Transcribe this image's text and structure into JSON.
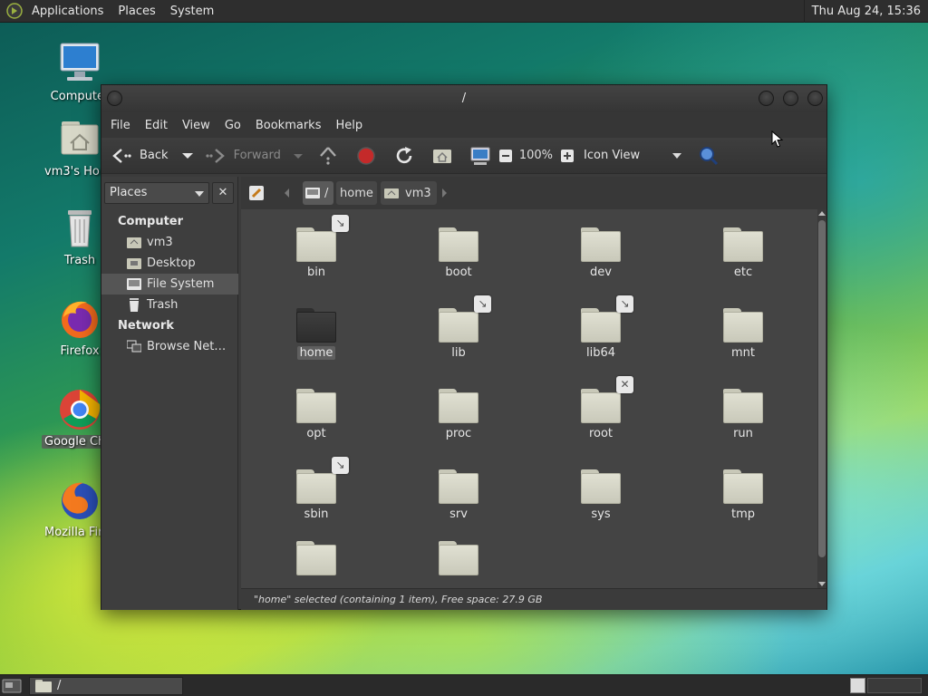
{
  "top_panel": {
    "menus": [
      "Applications",
      "Places",
      "System"
    ],
    "clock": "Thu Aug 24, 15:36"
  },
  "desktop": {
    "icons": [
      {
        "label": "Computer"
      },
      {
        "label": "vm3's Home"
      },
      {
        "label": "Trash"
      },
      {
        "label": "Firefox"
      },
      {
        "label": "Google Chrome"
      },
      {
        "label": "Mozilla Firefox"
      }
    ]
  },
  "window": {
    "title": "/",
    "menubar": [
      "File",
      "Edit",
      "View",
      "Go",
      "Bookmarks",
      "Help"
    ],
    "toolbar": {
      "back": "Back",
      "forward": "Forward",
      "zoom": "100%",
      "view_mode": "Icon View"
    },
    "pathbar": [
      "/",
      "home",
      "vm3"
    ],
    "sidebar": {
      "combo": "Places",
      "close": "✕",
      "sections": [
        {
          "title": "Computer",
          "items": [
            "vm3",
            "Desktop",
            "File System",
            "Trash"
          ]
        },
        {
          "title": "Network",
          "items": [
            "Browse Net…"
          ]
        }
      ]
    },
    "folders": [
      {
        "name": "bin",
        "emblem": "link"
      },
      {
        "name": "boot"
      },
      {
        "name": "dev"
      },
      {
        "name": "etc"
      },
      {
        "name": "home",
        "selected": true
      },
      {
        "name": "lib",
        "emblem": "link"
      },
      {
        "name": "lib64",
        "emblem": "link"
      },
      {
        "name": "mnt"
      },
      {
        "name": "opt"
      },
      {
        "name": "proc"
      },
      {
        "name": "root",
        "emblem": "no-access"
      },
      {
        "name": "run"
      },
      {
        "name": "sbin",
        "emblem": "link"
      },
      {
        "name": "srv"
      },
      {
        "name": "sys"
      },
      {
        "name": "tmp"
      },
      {
        "name": ""
      },
      {
        "name": ""
      }
    ],
    "status": "\"home\" selected (containing 1 item), Free space: 27.9 GB"
  },
  "bottom_panel": {
    "task_label": "/"
  }
}
